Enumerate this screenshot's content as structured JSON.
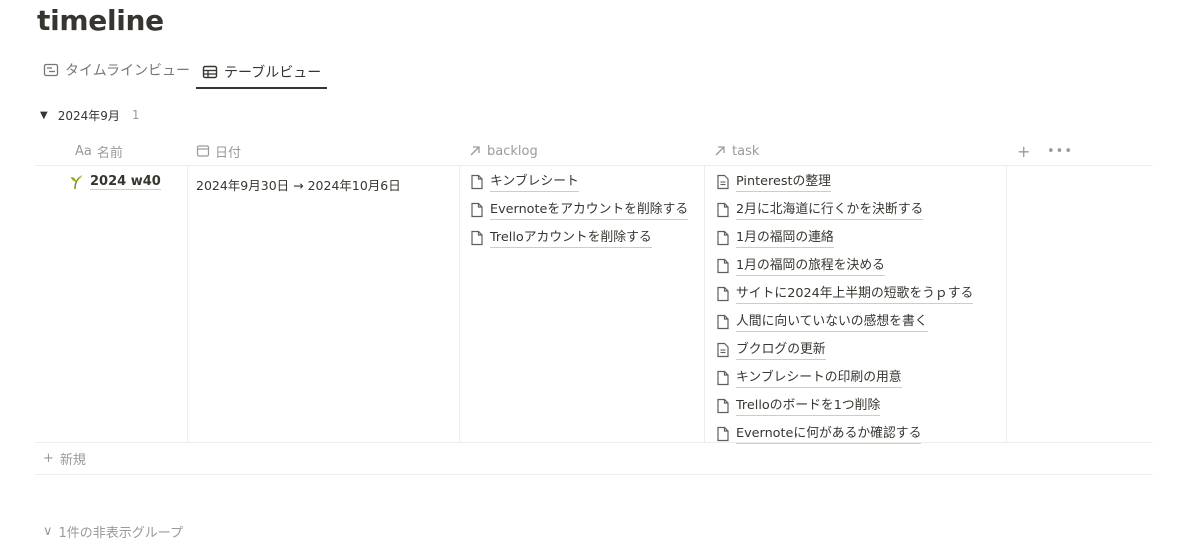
{
  "page": {
    "title": "timeline"
  },
  "tabs": [
    {
      "label": "タイムラインビュー",
      "icon": "timeline-view-icon",
      "active": false
    },
    {
      "label": "テーブルビュー",
      "icon": "table-view-icon",
      "active": true
    }
  ],
  "group": {
    "label": "2024年9月",
    "count": "1"
  },
  "columns": {
    "name": {
      "prefix": "Aa",
      "label": "名前"
    },
    "date": {
      "label": "日付",
      "icon": "calendar-icon"
    },
    "backlog": {
      "label": "backlog",
      "icon": "relation-arrow-icon"
    },
    "task": {
      "label": "task",
      "icon": "relation-arrow-icon"
    },
    "add": "+",
    "more": "•••"
  },
  "row": {
    "name": "2024 w40",
    "icon": "sprout-icon",
    "date": "2024年9月30日 → 2024年10月6日",
    "backlog": [
      {
        "text": "キンブレシート",
        "icon": "page-icon"
      },
      {
        "text": "Evernoteをアカウントを削除する",
        "icon": "page-icon"
      },
      {
        "text": "Trelloアカウントを削除する",
        "icon": "page-icon"
      }
    ],
    "task": [
      {
        "text": "Pinterestの整理",
        "icon": "page-text-icon"
      },
      {
        "text": "2月に北海道に行くかを決断する",
        "icon": "page-icon"
      },
      {
        "text": "1月の福岡の連絡",
        "icon": "page-icon"
      },
      {
        "text": "1月の福岡の旅程を決める",
        "icon": "page-icon"
      },
      {
        "text": "サイトに2024年上半期の短歌をうｐする",
        "icon": "page-icon"
      },
      {
        "text": "人間に向いていないの感想を書く",
        "icon": "page-icon"
      },
      {
        "text": "ブクログの更新",
        "icon": "page-text-icon"
      },
      {
        "text": "キンブレシートの印刷の用意",
        "icon": "page-icon"
      },
      {
        "text": "Trelloのボードを1つ削除",
        "icon": "page-icon"
      },
      {
        "text": "Evernoteに何があるか確認する",
        "icon": "page-icon"
      }
    ]
  },
  "new_row": {
    "icon": "+",
    "label": "新規"
  },
  "hidden_groups": {
    "icon": "∨",
    "label": "1件の非表示グループ"
  }
}
